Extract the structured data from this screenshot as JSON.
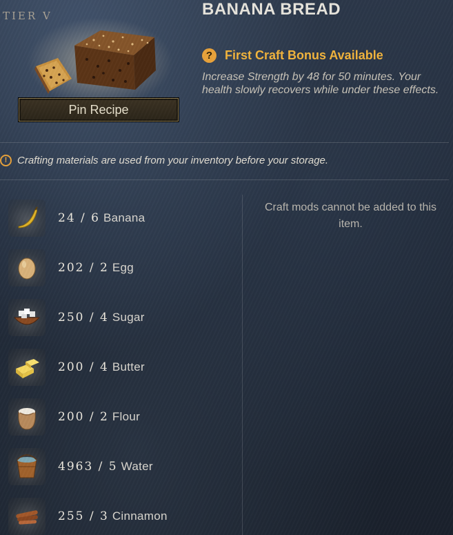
{
  "tier_label": "TIER V",
  "item": {
    "title": "BANANA BREAD",
    "image_icon": "banana-bread-icon"
  },
  "pin_button_label": "Pin Recipe",
  "bonus": {
    "label": "First Craft Bonus Available",
    "description": "Increase Strength by 48 for 50 minutes. Your health slowly recovers while under these effects."
  },
  "notice": "Crafting materials are used from your inventory before your storage.",
  "materials": [
    {
      "count": "24 / 6",
      "name": "Banana",
      "icon": "banana-icon"
    },
    {
      "count": "202 / 2",
      "name": "Egg",
      "icon": "egg-icon"
    },
    {
      "count": "250 / 4",
      "name": "Sugar",
      "icon": "sugar-icon"
    },
    {
      "count": "200 / 4",
      "name": "Butter",
      "icon": "butter-icon"
    },
    {
      "count": "200 / 2",
      "name": "Flour",
      "icon": "flour-sack-icon"
    },
    {
      "count": "4963 / 5",
      "name": "Water",
      "icon": "water-bucket-icon"
    },
    {
      "count": "255 / 3",
      "name": "Cinnamon",
      "icon": "cinnamon-icon"
    }
  ],
  "mods_note": "Craft mods cannot be added to this item.",
  "colors": {
    "accent_gold": "#f2b43c",
    "icon_orange": "#e8a23a",
    "background": "#1e2735"
  }
}
